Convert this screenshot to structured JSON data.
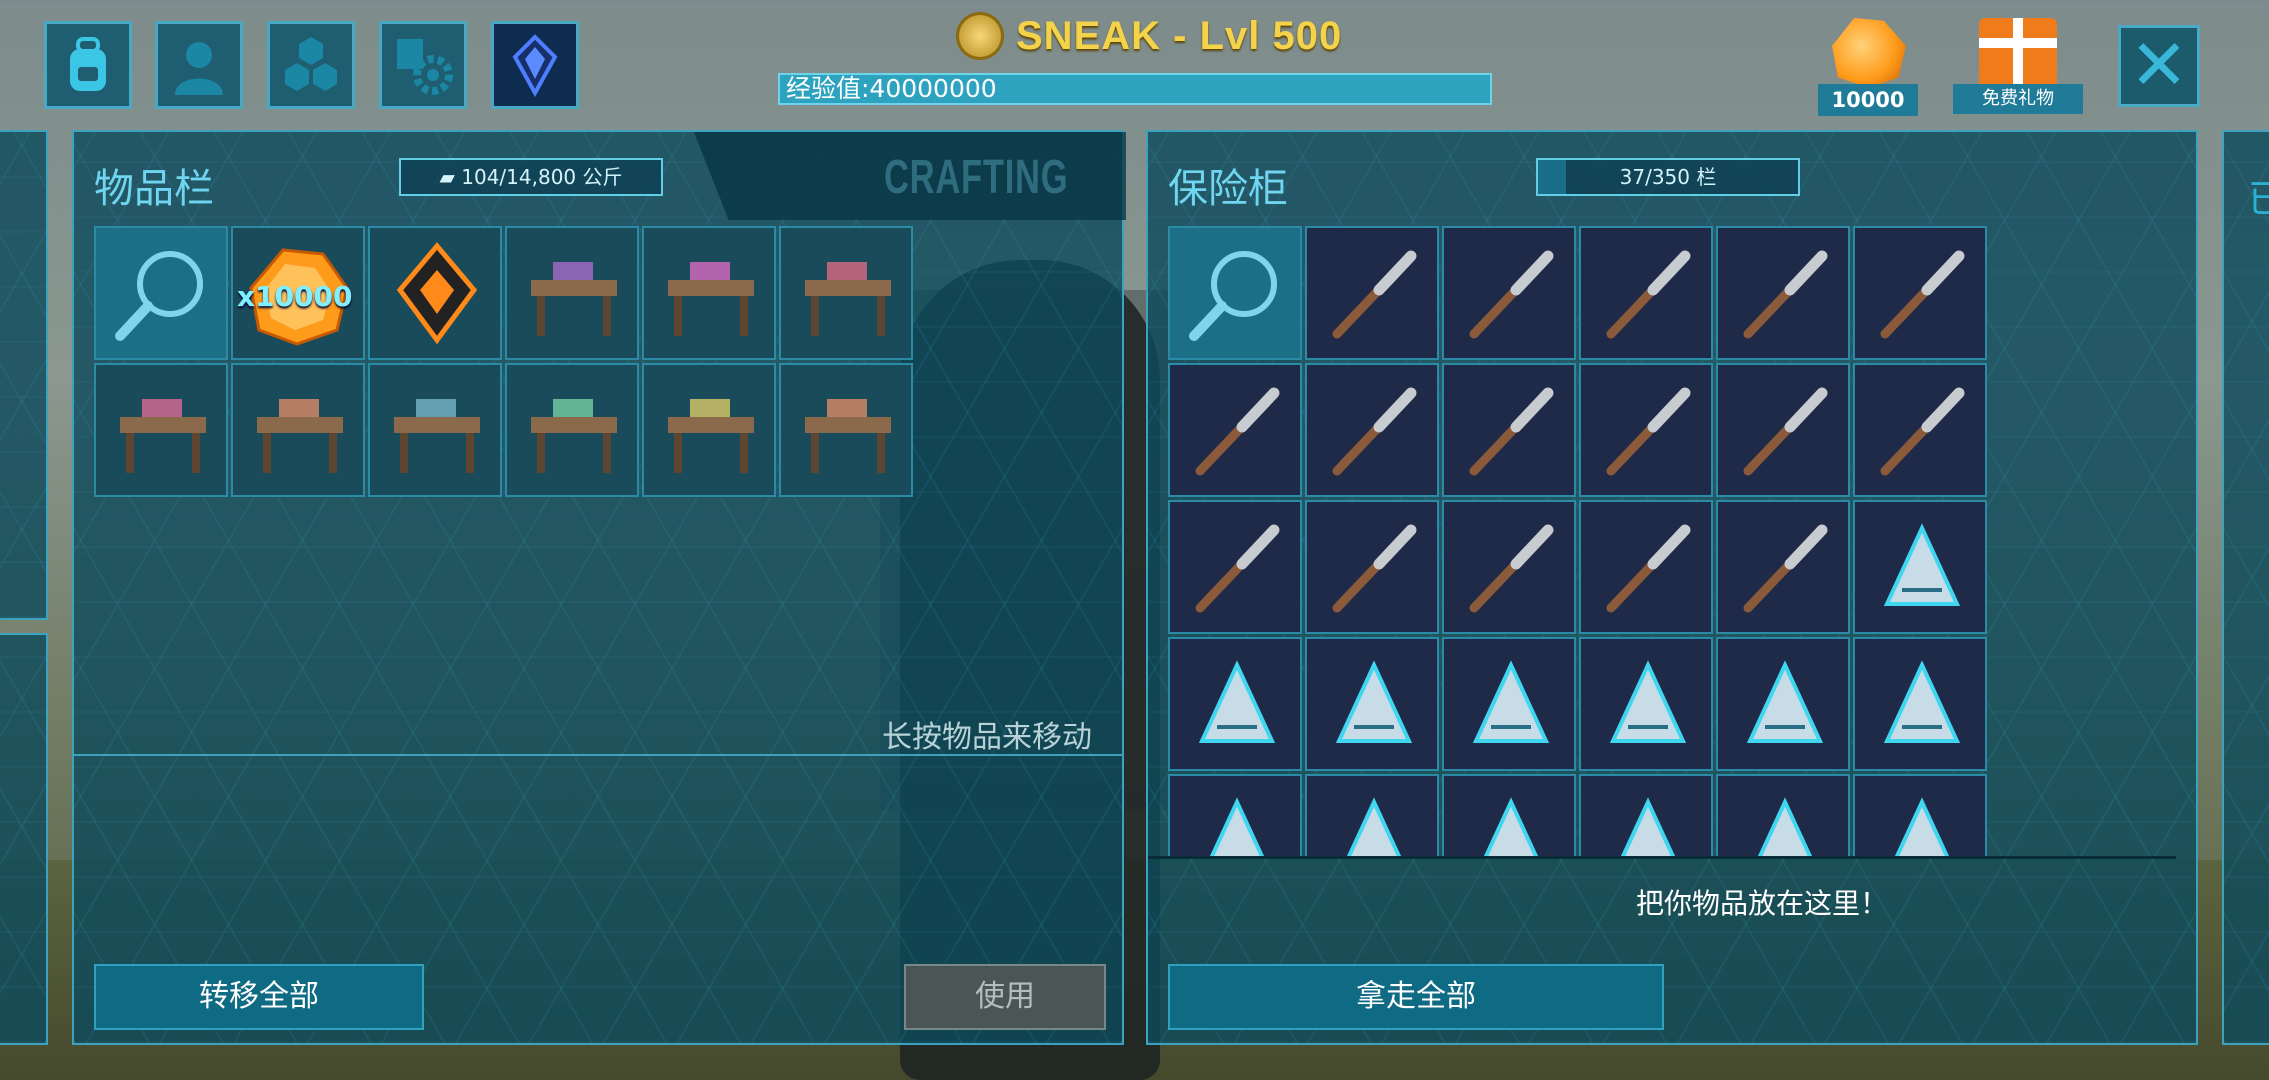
{
  "topbar": {
    "buttons": [
      {
        "icon": "backpack-icon"
      },
      {
        "icon": "player-icon"
      },
      {
        "icon": "tribe-hexagons-icon"
      },
      {
        "icon": "settings-icon"
      },
      {
        "icon": "crystal-icon"
      }
    ],
    "player_title": "SNEAK - Lvl 500",
    "xp_text": "经验值:40000000",
    "element_count": "10000",
    "free_gift_label": "免费礼物"
  },
  "inventory": {
    "title": "物品栏",
    "weight": "104/14,800 公斤",
    "crafting_tab": "CRAFTING",
    "items": [
      {
        "icon": "search-icon",
        "qty": ""
      },
      {
        "icon": "element-icon",
        "qty": "x10000"
      },
      {
        "icon": "tek-transmitter-icon",
        "qty": ""
      },
      {
        "icon": "smithy-table-icon",
        "qty": ""
      },
      {
        "icon": "storage-shelf-icon",
        "qty": ""
      },
      {
        "icon": "crafting-bench-icon",
        "qty": ""
      },
      {
        "icon": "loom-icon",
        "qty": ""
      },
      {
        "icon": "chemistry-bench-icon",
        "qty": ""
      },
      {
        "icon": "fabricator-icon",
        "qty": ""
      },
      {
        "icon": "bookshelf-icon",
        "qty": ""
      },
      {
        "icon": "industrial-forge-icon",
        "qty": ""
      },
      {
        "icon": "cooking-station-icon",
        "qty": ""
      }
    ],
    "hint": "长按物品来移动",
    "transfer_all": "转移全部",
    "use": "使用"
  },
  "vault": {
    "title": "保险柜",
    "capacity": "37/350 栏",
    "capacity_fraction": 0.106,
    "items": [
      {
        "icon": "search-icon"
      },
      {
        "icon": "torch-icon"
      },
      {
        "icon": "shield-icon"
      },
      {
        "icon": "pickaxe-icon"
      },
      {
        "icon": "hatchet-icon"
      },
      {
        "icon": "sword-icon"
      },
      {
        "icon": "pike-icon"
      },
      {
        "icon": "flintlock-icon"
      },
      {
        "icon": "shotgun-icon"
      },
      {
        "icon": "longneck-rifle-icon"
      },
      {
        "icon": "sniper-rifle-icon"
      },
      {
        "icon": "pump-shotgun-icon"
      },
      {
        "icon": "rocket-launcher-icon"
      },
      {
        "icon": "assault-rifle-icon"
      },
      {
        "icon": "pistol-icon"
      },
      {
        "icon": "compound-bow-icon"
      },
      {
        "icon": "riot-shield-icon"
      },
      {
        "icon": "tek-helmet-icon"
      },
      {
        "icon": "tek-armor-piece-icon"
      },
      {
        "icon": "tek-gauntlet-icon"
      },
      {
        "icon": "tek-triangle-icon"
      },
      {
        "icon": "tek-panel-icon"
      },
      {
        "icon": "tek-pillar-icon"
      },
      {
        "icon": "tek-staircase-icon"
      },
      {
        "icon": "tek-ceiling-triangle-icon"
      },
      {
        "icon": "tek-railing-icon"
      },
      {
        "icon": "tek-fence-icon"
      },
      {
        "icon": "tek-hatchframe-icon"
      },
      {
        "icon": "tek-wall-icon"
      },
      {
        "icon": "tek-doorframe-icon"
      }
    ],
    "drop_hint": "把你物品放在这里！",
    "take_all": "拿走全部"
  },
  "colors": {
    "accent": "#3ea2bf",
    "panel_bg": "#0d4a5c",
    "title_text": "#6fd5f0",
    "player_title": "#f4d24a"
  }
}
